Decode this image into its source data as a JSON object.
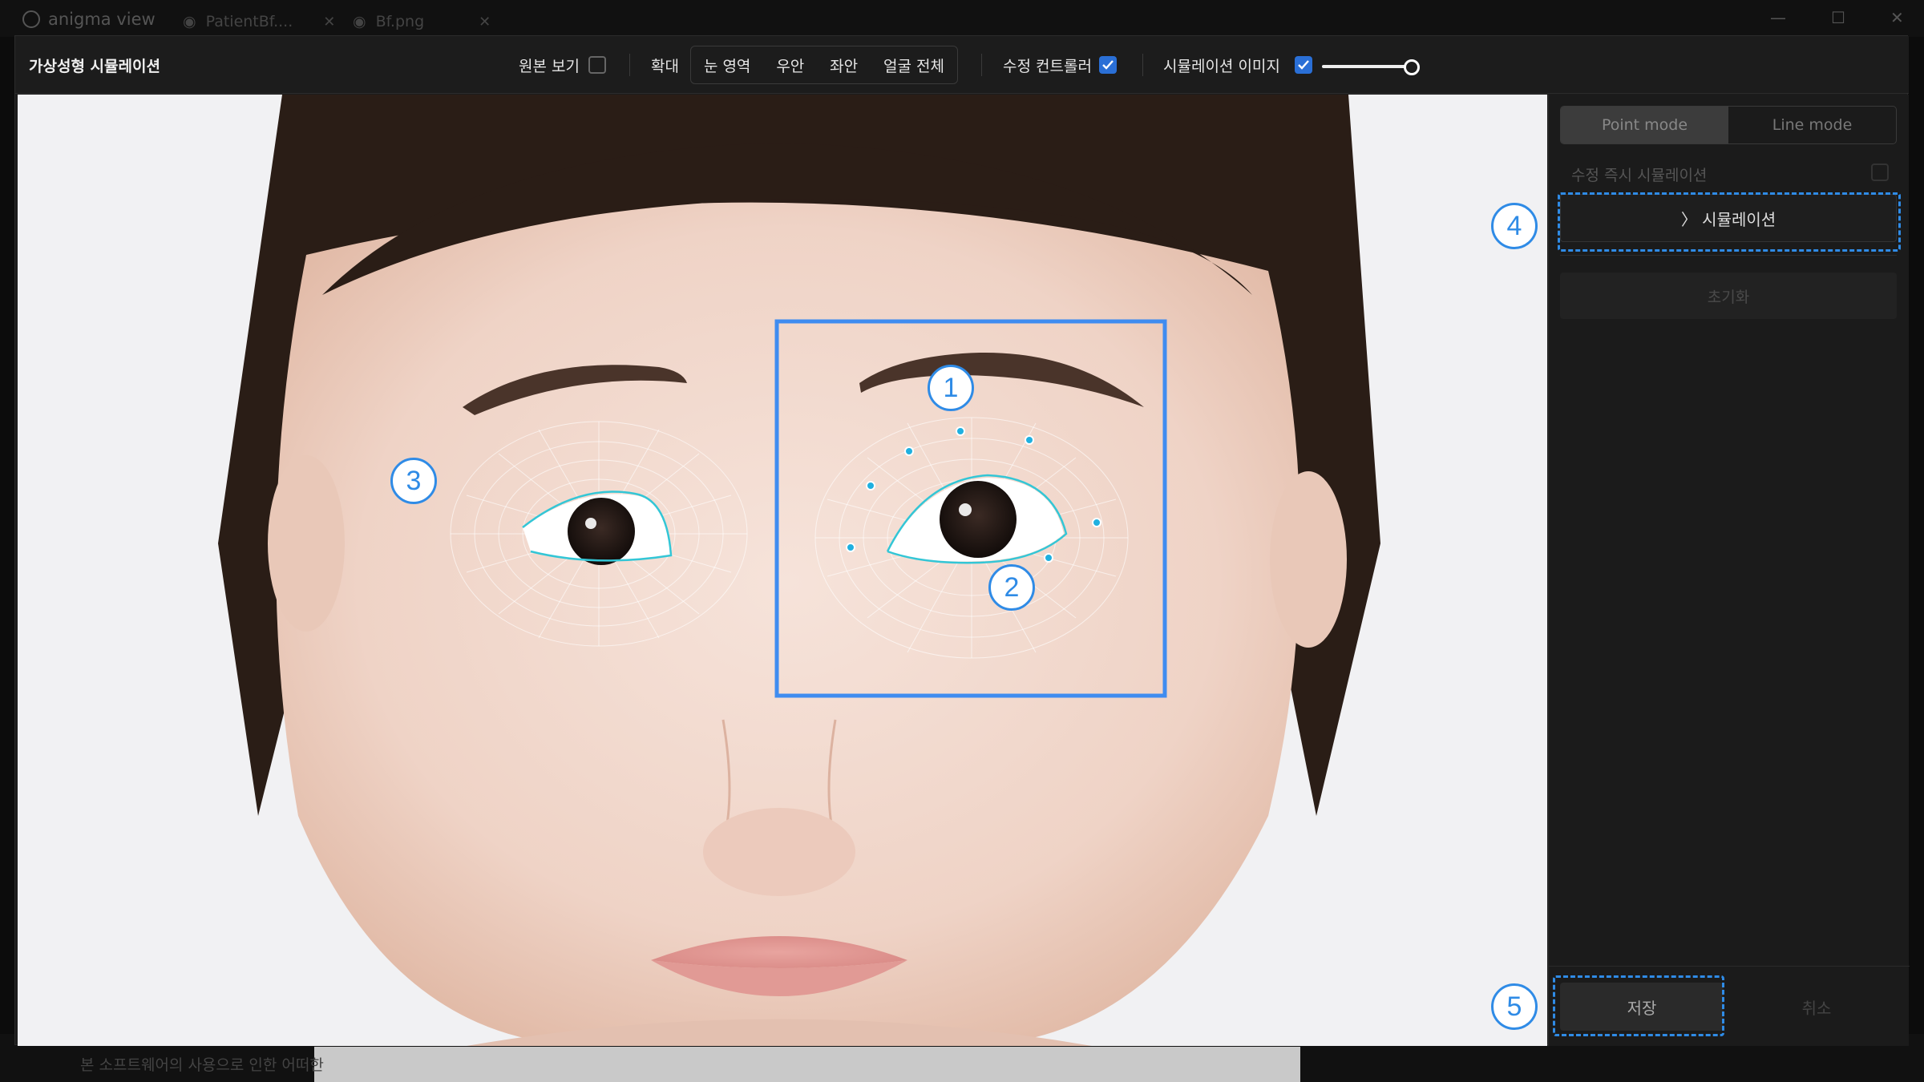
{
  "app": {
    "name": "anigma view",
    "tabs": [
      {
        "label": "PatientBf...."
      },
      {
        "label": "Bf.png"
      }
    ]
  },
  "behind": {
    "notice": "본 소프트웨어의 사용으로 인한 어떠한"
  },
  "dialog": {
    "title": "가상성형 시뮬레이션",
    "toolbar": {
      "show_original_label": "원본 보기",
      "show_original_checked": false,
      "zoom_label": "확대",
      "zoom_options": [
        "눈 영역",
        "우안",
        "좌안",
        "얼굴 전체"
      ],
      "edit_controller_label": "수정 컨트롤러",
      "edit_controller_checked": true,
      "sim_image_label": "시뮬레이션 이미지",
      "sim_image_checked": true,
      "sim_image_opacity": 1.0
    },
    "panel": {
      "mode_point": "Point mode",
      "mode_line": "Line mode",
      "active_mode": "Point mode",
      "instant_sim_label": "수정 즉시 시뮬레이션",
      "simulate_button": "〉 시뮬레이션",
      "reset_button": "초기화",
      "save_button": "저장",
      "cancel_button": "취소"
    }
  },
  "annotations": [
    "1",
    "2",
    "3",
    "4",
    "5"
  ],
  "colors": {
    "accent": "#2f8be6",
    "checkbox": "#2a6fd6",
    "contour": "#33c6d6"
  }
}
